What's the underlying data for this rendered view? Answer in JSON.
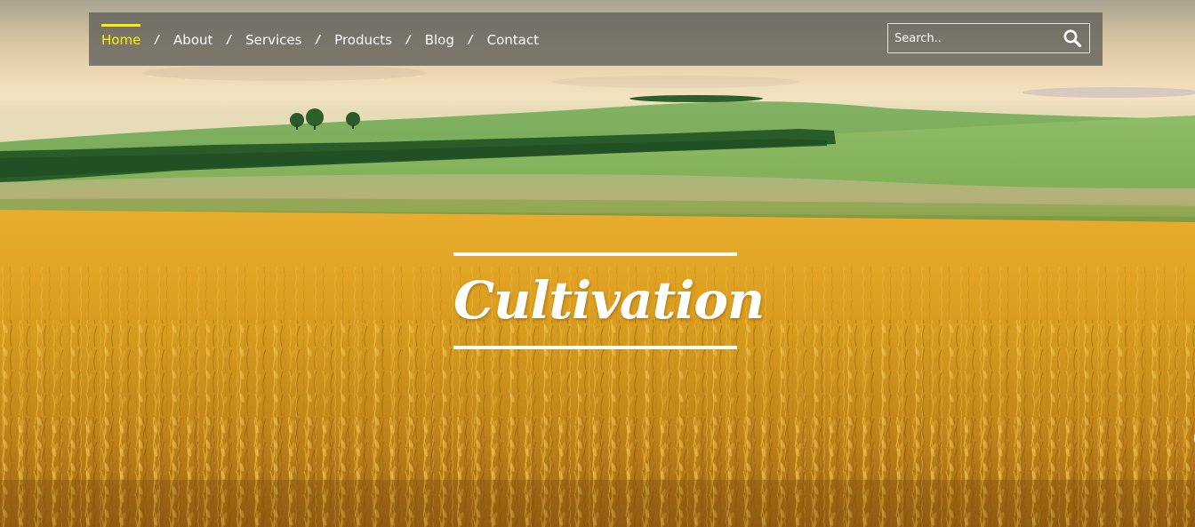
{
  "nav": {
    "items": [
      {
        "label": "Home",
        "active": true
      },
      {
        "label": "About",
        "active": false
      },
      {
        "label": "Services",
        "active": false
      },
      {
        "label": "Products",
        "active": false
      },
      {
        "label": "Blog",
        "active": false
      },
      {
        "label": "Contact",
        "active": false
      }
    ],
    "separator": "/",
    "active_color": "#fff200",
    "bar_color": "#5f5d5a"
  },
  "search": {
    "placeholder": "Search..",
    "value": "",
    "icon": "magnifier-icon"
  },
  "hero": {
    "title": "Cultivation",
    "background": "wheat-field-with-green-hills-photo",
    "title_color": "#ffffff"
  }
}
